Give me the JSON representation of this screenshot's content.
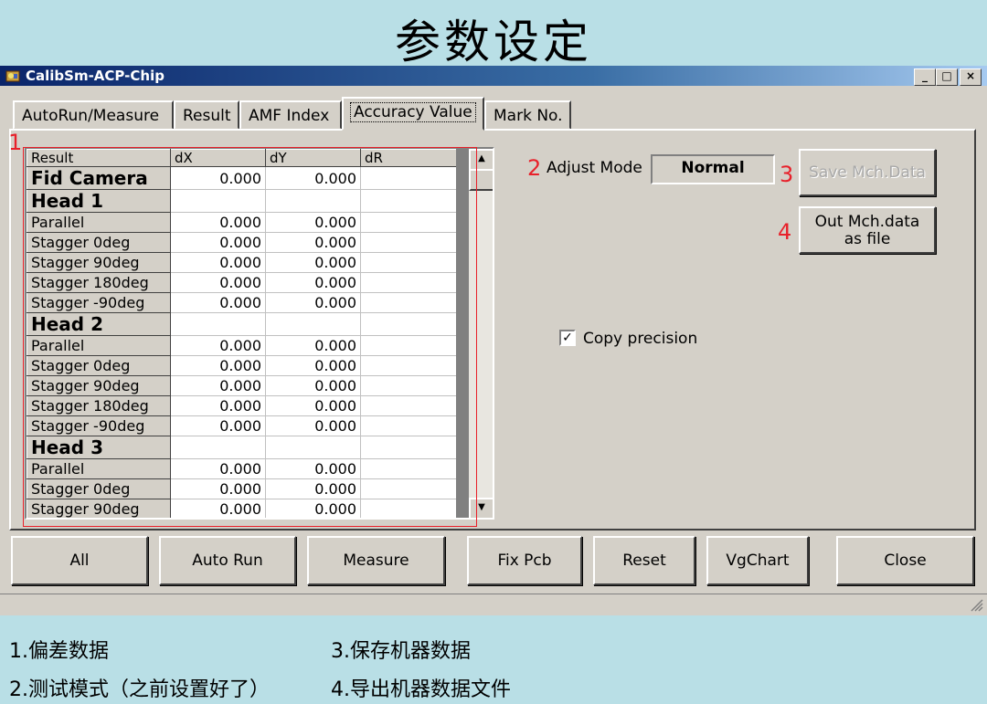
{
  "slide_title": "参数设定",
  "window": {
    "title": "CalibSm-ACP-Chip",
    "controls": [
      "_",
      "□",
      "×"
    ]
  },
  "tabs": [
    {
      "label": "AutoRun/Measure"
    },
    {
      "label": "Result"
    },
    {
      "label": "AMF Index"
    },
    {
      "label": "Accuracy Value",
      "active": true
    },
    {
      "label": "Mark No."
    }
  ],
  "annotations": {
    "n1": "1",
    "n2": "2",
    "n3": "3",
    "n4": "4"
  },
  "grid": {
    "columns": [
      "Result",
      "dX",
      "dY",
      "dR"
    ],
    "rows": [
      {
        "label": "Fid Camera",
        "big": true,
        "dx": "0.000",
        "dy": "0.000",
        "dr": ""
      },
      {
        "label": "Head 1",
        "big": true,
        "dx": "",
        "dy": "",
        "dr": ""
      },
      {
        "label": "Parallel",
        "dx": "0.000",
        "dy": "0.000",
        "dr": ""
      },
      {
        "label": "Stagger 0deg",
        "dx": "0.000",
        "dy": "0.000",
        "dr": ""
      },
      {
        "label": "Stagger 90deg",
        "dx": "0.000",
        "dy": "0.000",
        "dr": ""
      },
      {
        "label": "Stagger 180deg",
        "dx": "0.000",
        "dy": "0.000",
        "dr": ""
      },
      {
        "label": "Stagger -90deg",
        "dx": "0.000",
        "dy": "0.000",
        "dr": ""
      },
      {
        "label": "Head 2",
        "big": true,
        "dx": "",
        "dy": "",
        "dr": ""
      },
      {
        "label": "Parallel",
        "dx": "0.000",
        "dy": "0.000",
        "dr": ""
      },
      {
        "label": "Stagger 0deg",
        "dx": "0.000",
        "dy": "0.000",
        "dr": ""
      },
      {
        "label": "Stagger 90deg",
        "dx": "0.000",
        "dy": "0.000",
        "dr": ""
      },
      {
        "label": "Stagger 180deg",
        "dx": "0.000",
        "dy": "0.000",
        "dr": ""
      },
      {
        "label": "Stagger -90deg",
        "dx": "0.000",
        "dy": "0.000",
        "dr": ""
      },
      {
        "label": "Head 3",
        "big": true,
        "dx": "",
        "dy": "",
        "dr": ""
      },
      {
        "label": "Parallel",
        "dx": "0.000",
        "dy": "0.000",
        "dr": ""
      },
      {
        "label": "Stagger 0deg",
        "dx": "0.000",
        "dy": "0.000",
        "dr": ""
      },
      {
        "label": "Stagger 90deg",
        "dx": "0.000",
        "dy": "0.000",
        "dr": ""
      }
    ]
  },
  "adjust_mode": {
    "label": "Adjust Mode",
    "value": "Normal"
  },
  "save_button": "Save Mch.Data",
  "out_button": {
    "line1": "Out Mch.data",
    "line2": "as file"
  },
  "copy_precision": {
    "label": "Copy precision",
    "checked": true
  },
  "bottom_buttons": [
    "All",
    "Auto Run",
    "Measure",
    "Fix Pcb",
    "Reset",
    "VgChart",
    "Close"
  ],
  "notes": {
    "n1": "1.偏差数据",
    "n2": "2.测试模式（之前设置好了）",
    "n3": "3.保存机器数据",
    "n4": "4.导出机器数据文件"
  },
  "colors": {
    "accent_red": "#e8202a",
    "title_bar": "#0a246a",
    "face": "#d4d0c8",
    "slide_bg": "#b9dfe6"
  }
}
